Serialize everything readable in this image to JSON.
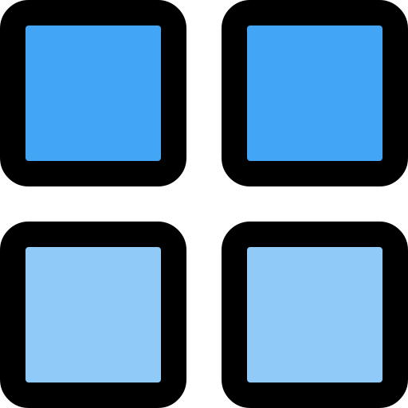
{
  "icon": {
    "name": "grid-icon",
    "tiles": [
      {
        "name": "tile-top-left",
        "fill": "#42A5F5"
      },
      {
        "name": "tile-top-right",
        "fill": "#42A5F5"
      },
      {
        "name": "tile-bottom-left",
        "fill": "#90CAF9"
      },
      {
        "name": "tile-bottom-right",
        "fill": "#90CAF9"
      }
    ],
    "stroke": "#000000"
  }
}
